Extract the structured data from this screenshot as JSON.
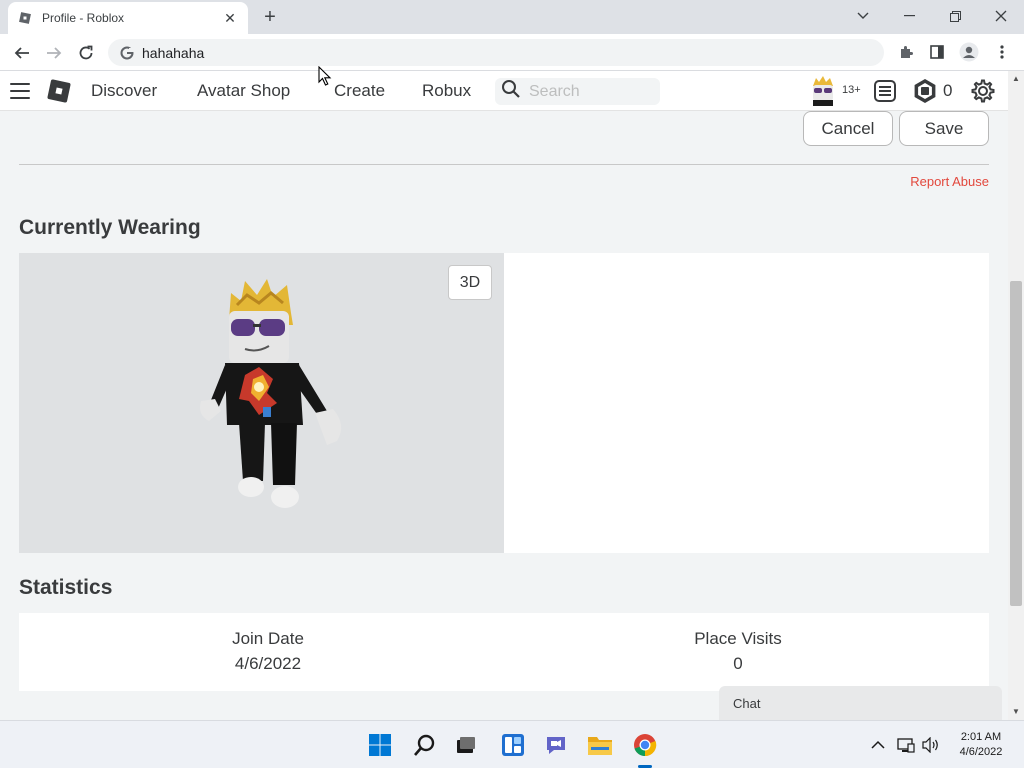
{
  "browser": {
    "tab_title": "Profile - Roblox",
    "tab_close": "✕",
    "new_tab": "+",
    "address": "hahahaha"
  },
  "header": {
    "nav": [
      "Discover",
      "Avatar Shop",
      "Create",
      "Robux"
    ],
    "search_placeholder": "Search",
    "age_badge": "13+",
    "robux_count": "0"
  },
  "actions": {
    "cancel": "Cancel",
    "save": "Save"
  },
  "profile": {
    "report_abuse": "Report Abuse",
    "currently_wearing": "Currently Wearing",
    "view_3d": "3D"
  },
  "statistics": {
    "title": "Statistics",
    "items": [
      {
        "label": "Join Date",
        "value": "4/6/2022"
      },
      {
        "label": "Place Visits",
        "value": "0"
      }
    ]
  },
  "chat": {
    "label": "Chat"
  },
  "scrollbar": {
    "up": "▲",
    "down": "▼"
  },
  "taskbar": {
    "time": "2:01 AM",
    "date": "4/6/2022"
  },
  "colors": {
    "accent_link": "#e2483d",
    "page_bg": "#f2f4f5",
    "taskbar_accent": "#0067c0"
  },
  "icons": {
    "tab_favicon": "roblox-favicon-icon",
    "back": "arrow-left-icon",
    "forward": "arrow-right-icon",
    "reload": "reload-icon",
    "site": "google-g-icon",
    "extensions": "puzzle-icon",
    "sidepanel": "side-panel-icon",
    "profile": "profile-icon",
    "menu": "kebab-menu-icon",
    "hamburger": "hamburger-icon",
    "logo": "roblox-logo-icon",
    "search": "search-icon",
    "messages": "list-icon",
    "robux": "robux-icon",
    "settings": "gear-icon"
  }
}
